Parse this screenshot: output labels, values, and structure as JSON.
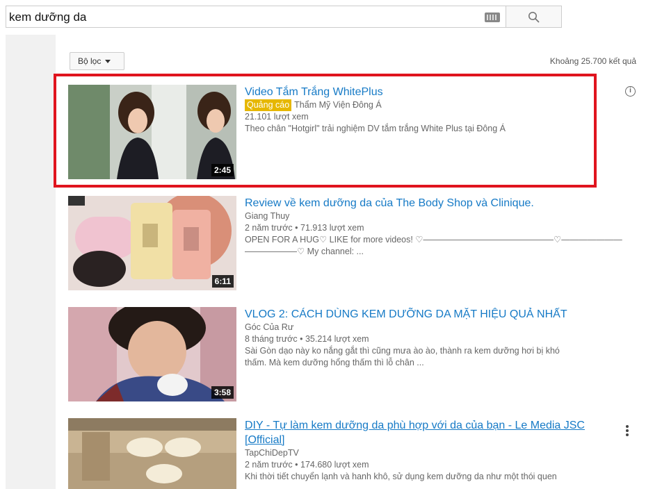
{
  "search": {
    "query": "kem dưỡng da"
  },
  "filter": {
    "label": "Bộ lọc",
    "result_count": "Khoảng 25.700 kết quả"
  },
  "results": [
    {
      "title": "Video Tắm Trắng WhitePlus",
      "ad_badge": "Quảng cáo",
      "channel": "Thẩm Mỹ Viện Đông Á",
      "stats": "21.101 lượt xem",
      "description": "Theo chân \"Hotgirl\" trải nghiệm DV tắm trắng White Plus tại Đông Á",
      "duration": "2:45"
    },
    {
      "title": "Review về kem dưỡng da của The Body Shop và Clinique.",
      "channel": "Giang Thuy",
      "stats": "2 năm trước • 71.913 lượt xem",
      "description_line1": "OPEN FOR A HUG♡ LIKE for more videos! ♡———————————————♡———————",
      "description_line2": "——————♡ My channel: ...",
      "duration": "6:11"
    },
    {
      "title": "VLOG 2: CÁCH DÙNG KEM DƯỠNG DA MẶT HIỆU QUẢ NHẤT",
      "channel": "Góc Của Rư",
      "stats": "8 tháng trước • 35.214 lượt xem",
      "description_line1": "Sài Gòn dạo này ko nắng gắt thì cũng mưa ào ào, thành ra kem dưỡng hơi bị khó",
      "description_line2": "thấm. Mà kem dưỡng hổng thấm thì lỗ chân ...",
      "duration": "3:58"
    },
    {
      "title_line1": "DIY - Tự làm kem dưỡng da phù hợp với da của bạn - Le Media JSC",
      "title_line2": "[Official]",
      "channel": "TapChiDepTV",
      "stats": "2 năm trước • 174.680 lượt xem",
      "description_line1": "Khi thời tiết chuyển lạnh và hanh khô, sử dụng kem dưỡng da như một thói quen"
    }
  ],
  "colors": {
    "link": "#167ac6",
    "ad_badge": "#e6b700",
    "highlight": "#e0141e"
  }
}
